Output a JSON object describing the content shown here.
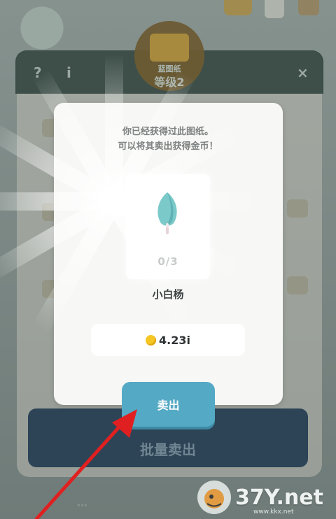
{
  "background": {
    "panel_subtitle": "蓝图纸",
    "panel_title": "等级2",
    "help_button": "?",
    "info_button": "i",
    "close_button": "×",
    "bulk_sell_button": "批量卖出"
  },
  "dialog": {
    "message_line1": "你已经获得过此图纸。",
    "message_line2": "可以将其卖出获得金币！",
    "item": {
      "icon": "white-poplar-tree-icon",
      "count": "0/3",
      "name": "小白杨"
    },
    "price": "4.23i",
    "coin_icon": "gold-coin-icon",
    "sell_button": "卖出"
  },
  "watermark": {
    "text": "37Y.net",
    "subtext": "www.kkx.net"
  },
  "colors": {
    "sell_button": "#54a9c5",
    "coin": "#f6c623",
    "tree": "#7cc9c9",
    "arrow": "#e02020"
  }
}
